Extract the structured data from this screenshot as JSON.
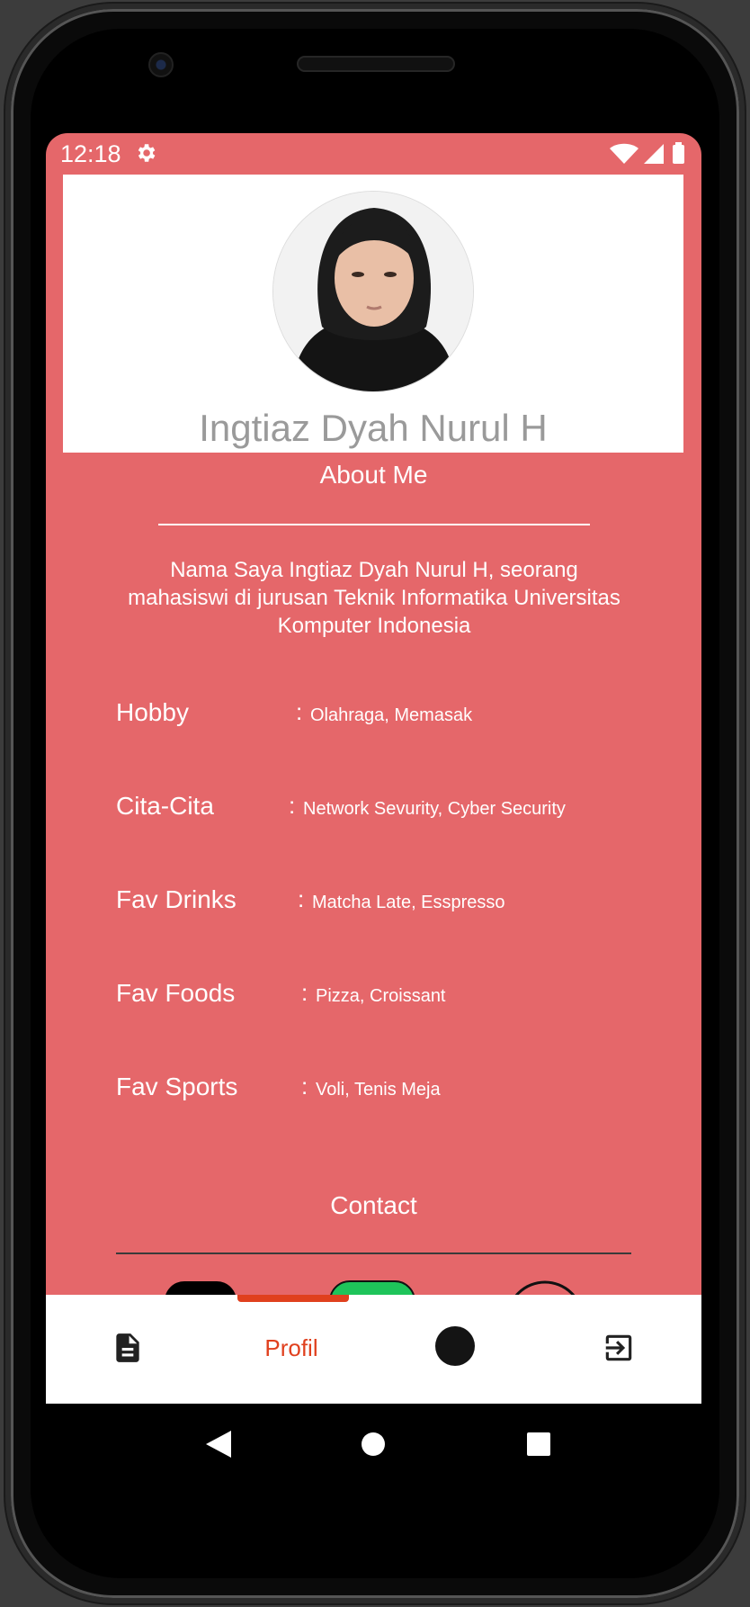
{
  "status_bar": {
    "time": "12:18",
    "icons": [
      "gear-icon",
      "wifi-icon",
      "signal-icon",
      "battery-icon"
    ]
  },
  "profile": {
    "name": "Ingtiaz Dyah Nurul H"
  },
  "about": {
    "title": "About Me",
    "text": "Nama Saya Ingtiaz Dyah Nurul H, seorang mahasiswi di jurusan Teknik Informatika Universitas Komputer Indonesia"
  },
  "details": [
    {
      "label": "Hobby",
      "colon": ":",
      "value": "Olahraga, Memasak"
    },
    {
      "label": "Cita-Cita",
      "colon": ":",
      "value": "Network Sevurity, Cyber Security"
    },
    {
      "label": "Fav Drinks",
      "colon": ":",
      "value": "Matcha Late, Esspresso"
    },
    {
      "label": "Fav Foods",
      "colon": ":",
      "value": "Pizza, Croissant"
    },
    {
      "label": "Fav Sports",
      "colon": ":",
      "value": "Voli, Tenis Meja"
    }
  ],
  "contact": {
    "title": "Contact",
    "icons": [
      "black-app-icon",
      "green-app-icon",
      "circle-app-icon"
    ]
  },
  "bottom_nav": {
    "items": [
      {
        "icon": "document-icon"
      },
      {
        "label": "Profil",
        "active": true
      },
      {
        "icon": "circle-icon"
      },
      {
        "icon": "exit-icon"
      }
    ]
  },
  "colors": {
    "primary": "#e5676a",
    "accent": "#e0401e"
  }
}
